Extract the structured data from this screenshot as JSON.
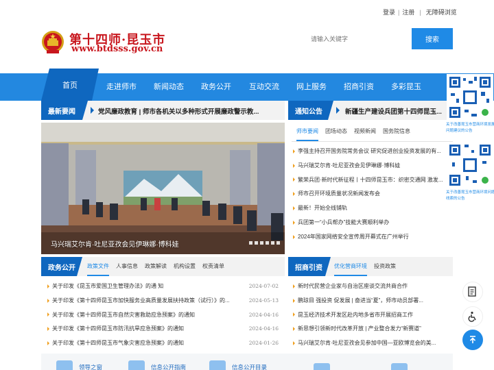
{
  "top_links": {
    "login": "登录",
    "register": "注册",
    "accessible": "无障碍浏览"
  },
  "logo": {
    "title": "第十四师·昆玉市",
    "url": "www.btdsss.gov.cn"
  },
  "search": {
    "placeholder": "请输入关键字",
    "button": "搜索"
  },
  "nav": {
    "home": "首页",
    "items": [
      "走进师市",
      "新闻动态",
      "政务公开",
      "互动交流",
      "网上服务",
      "招商引资",
      "多彩昆玉"
    ]
  },
  "latest_news": {
    "label": "最新要闻",
    "ticker": "党风廉政教育 | 师市各机关以多种形式开展廉政警示教...",
    "photo_caption": "马兴瑞艾尔肯·吐尼亚孜会见伊琳娜·博科娃"
  },
  "notice": {
    "label": "通知公告",
    "ticker": "新疆生产建设兵团第十四师昆玉..."
  },
  "news_tabs": [
    "师市要闻",
    "团场动态",
    "视频新闻",
    "国务院信息"
  ],
  "news_list": [
    "李强主持召开国务院常务会议 研究促进创业投资发展的有...",
    "马兴瑞艾尔肯·吐尼亚孜会见伊琳娜·博科娃",
    "繁荣兵团·新时代新征程丨十四师昆玉市：织密交通网 激发...",
    "师市召开环境质量状况新闻发布会",
    "最新！开始全线铺轨",
    "兵团第一“小兵帮办”技能大赛顺利举办",
    "2024年国家网络安全宣传周开幕式在广州举行"
  ],
  "gov": {
    "label": "政务公开",
    "tabs": [
      "政策文件",
      "人事信息",
      "政策解读",
      "机构设置",
      "权责清单"
    ],
    "items": [
      {
        "title": "关于印发《昆玉市爱国卫生管理办法》的通 知",
        "date": "2024-07-02"
      },
      {
        "title": "关于印发《第十四师昆玉市加快服务业高质量发展扶持政策（试行）》的...",
        "date": "2024-05-13"
      },
      {
        "title": "关于印发《第十四师昆玉市自然灾害救助应急预案》的通知",
        "date": "2024-04-16"
      },
      {
        "title": "关于印发《第十四师昆玉市防汛抗旱应急预案》的通知",
        "date": "2024-04-16"
      },
      {
        "title": "关于印发《第十四师昆玉市气象灾害应急预案》的通知",
        "date": "2024-01-26"
      }
    ]
  },
  "invest": {
    "label": "招商引资",
    "tabs": [
      "优化营商环境",
      "投资政策"
    ],
    "items": [
      "新时代民营企业家与自治区座谈交流共商合作",
      "鹏琼目 强投资 促发展 | 奋进当“夏”，师市动员部署...",
      "昆玉经济技术开发区赴内地多省市开展招商工作",
      "新思想引领新时代改革开放 | 产业整合发力“新赛道”",
      "马兴瑞艾尔肯·吐尼亚孜会见参加中国—亚欧博览会的美..."
    ]
  },
  "qr": {
    "caption1": [
      "关于改善昆玉市营商环境发展有关",
      "问题建议的公告"
    ],
    "caption2": [
      "关于改善昆玉市营商环境问题建议",
      "线索的公告"
    ]
  },
  "bottom": [
    "领导之窗",
    "信息公开指南",
    "信息公开目录"
  ],
  "icons": [
    "national-emblem-icon",
    "tri-arrow-icon",
    "document-icon",
    "wheelchair-icon",
    "back-to-top-icon",
    "wechat-icon"
  ],
  "colors": {
    "primary": "#2388e0",
    "dark_primary": "#0f67bf",
    "brand_red": "#c8161d",
    "accent": "#f0a020"
  }
}
